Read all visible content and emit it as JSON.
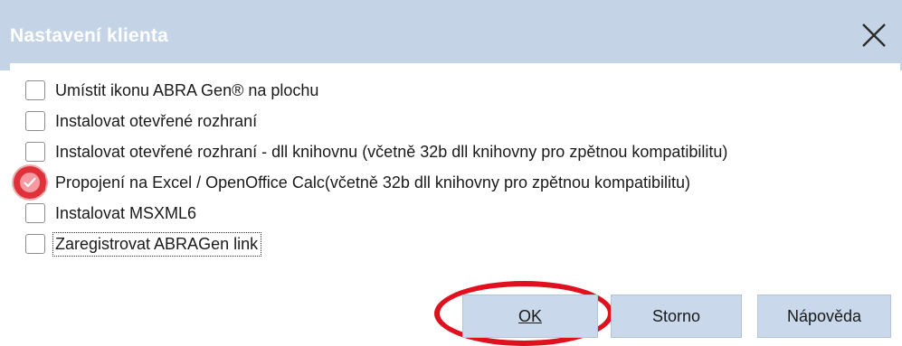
{
  "window": {
    "title": "Nastavení klienta",
    "close_icon": "close-icon"
  },
  "options": [
    {
      "label": "Umístit ikonu ABRA Gen® na plochu",
      "checked": false
    },
    {
      "label": "Instalovat otevřené rozhraní",
      "checked": false
    },
    {
      "label": "Instalovat otevřené rozhraní - dll knihovnu (včetně 32b dll knihovny pro zpětnou kompatibilitu)",
      "checked": false
    },
    {
      "label": "Propojení na Excel / OpenOffice Calc(včetně 32b dll knihovny pro zpětnou kompatibilitu)",
      "checked": true
    },
    {
      "label": "Instalovat MSXML6",
      "checked": false
    },
    {
      "label": "Zaregistrovat ABRAGen link",
      "checked": false,
      "focused": true
    }
  ],
  "buttons": {
    "ok_label": "OK",
    "storno_label": "Storno",
    "napoveda_label": "Nápověda"
  },
  "colors": {
    "titlebar": "#c4d3e5",
    "button": "#c9d8ea",
    "annotation_red": "#e0101e"
  }
}
